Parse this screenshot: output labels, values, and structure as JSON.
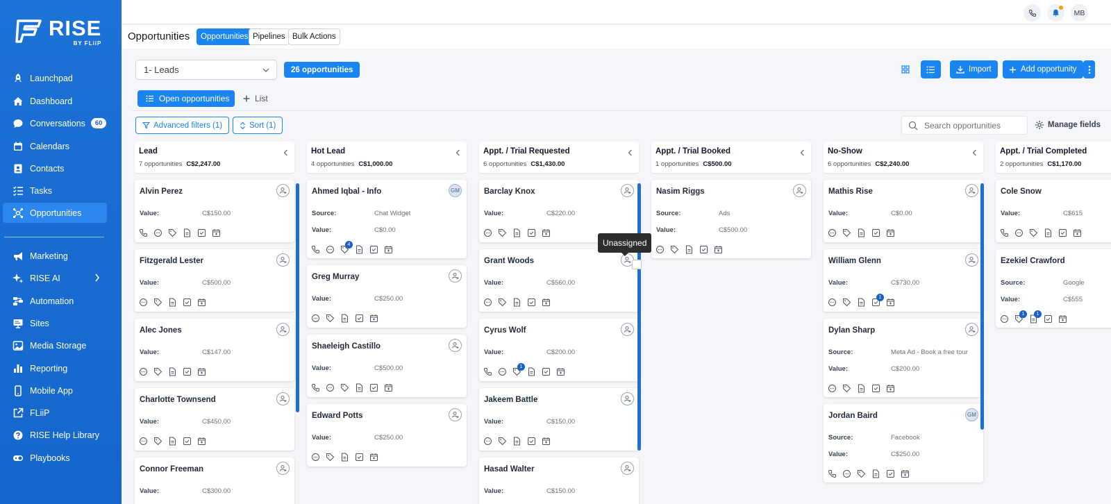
{
  "brand": {
    "name": "RISE",
    "tagline": "BY FLiiP"
  },
  "sidebar": {
    "items": [
      {
        "label": "Launchpad",
        "icon": "rocket-icon"
      },
      {
        "label": "Dashboard",
        "icon": "home-icon"
      },
      {
        "label": "Conversations",
        "icon": "chat-icon",
        "badge": "60"
      },
      {
        "label": "Calendars",
        "icon": "calendar-icon"
      },
      {
        "label": "Contacts",
        "icon": "contact-card-icon"
      },
      {
        "label": "Tasks",
        "icon": "tasks-list-icon"
      },
      {
        "label": "Opportunities",
        "icon": "opportunities-icon",
        "active": true
      },
      {
        "label": "Marketing",
        "icon": "megaphone-icon"
      },
      {
        "label": "RISE AI",
        "icon": "sparkle-icon"
      },
      {
        "label": "Automation",
        "icon": "workflow-icon"
      },
      {
        "label": "Sites",
        "icon": "monitor-icon"
      },
      {
        "label": "Media Storage",
        "icon": "image-icon"
      },
      {
        "label": "Reporting",
        "icon": "bar-chart-icon"
      },
      {
        "label": "Mobile App",
        "icon": "phone-icon"
      },
      {
        "label": "FLiiP",
        "icon": "external-link-icon"
      },
      {
        "label": "RISE Help Library",
        "icon": "help-circle-icon"
      },
      {
        "label": "Playbooks",
        "icon": "toggle-icon"
      }
    ]
  },
  "topbar": {
    "avatar_initials": "MB"
  },
  "header": {
    "title": "Opportunities",
    "tabs": [
      "Opportunities",
      "Pipelines",
      "Bulk Actions"
    ]
  },
  "toolbar": {
    "pipeline": "1- Leads",
    "count": "26 opportunities",
    "import": "Import",
    "add": "Add opportunity"
  },
  "views": {
    "active": "Open opportunities",
    "add_list": "List"
  },
  "filters": {
    "advanced": "Advanced filters (1)",
    "sort": "Sort (1)",
    "search_placeholder": "Search opportunities",
    "manage": "Manage fields"
  },
  "tooltip": "Unassigned",
  "labels": {
    "value": "Value:",
    "source": "Source:"
  },
  "columns": [
    {
      "name": "Lead",
      "count": "7 opportunities",
      "total": "C$2,247.00",
      "cards": [
        {
          "name": "Alvin Perez",
          "value": "C$150.00",
          "icons": [
            "phone",
            "chat",
            "tag",
            "doc",
            "check",
            "cal"
          ]
        },
        {
          "name": "Fitzgerald Lester",
          "value": "C$500.00",
          "icons": [
            "chat",
            "tag",
            "doc",
            "check",
            "cal"
          ]
        },
        {
          "name": "Alec Jones",
          "value": "C$147.00",
          "icons": [
            "chat",
            "tag",
            "doc",
            "check",
            "cal"
          ]
        },
        {
          "name": "Charlotte Townsend",
          "value": "C$450.00",
          "icons": [
            "chat",
            "tag",
            "doc",
            "check",
            "cal"
          ]
        },
        {
          "name": "Connor Freeman",
          "value": "C$300.00",
          "icons": []
        }
      ]
    },
    {
      "name": "Hot Lead",
      "count": "4 opportunities",
      "total": "C$1,000.00",
      "cards": [
        {
          "name": "Ahmed Iqbal - Info",
          "source": "Chat Widget",
          "value": "C$0.00",
          "avatar": "GM",
          "icons": [
            "phone",
            "chat",
            "tag:4",
            "doc",
            "check",
            "cal"
          ]
        },
        {
          "name": "Greg Murray",
          "value": "C$250.00",
          "icons": [
            "chat",
            "tag",
            "doc",
            "check",
            "cal"
          ]
        },
        {
          "name": "Shaeleigh Castillo",
          "value": "C$500.00",
          "icons": [
            "phone",
            "chat",
            "tag",
            "doc",
            "check",
            "cal"
          ]
        },
        {
          "name": "Edward Potts",
          "value": "C$250.00",
          "icons": [
            "chat",
            "tag",
            "doc",
            "check",
            "cal"
          ]
        }
      ]
    },
    {
      "name": "Appt. / Trial Requested",
      "count": "6 opportunities",
      "total": "C$1,430.00",
      "cards": [
        {
          "name": "Barclay Knox",
          "value": "C$220.00",
          "icons": [
            "chat",
            "tag",
            "doc",
            "check",
            "cal"
          ]
        },
        {
          "name": "Grant Woods",
          "value": "C$560.00",
          "icons": [
            "chat",
            "tag",
            "doc",
            "check",
            "cal"
          ]
        },
        {
          "name": "Cyrus Wolf",
          "value": "C$200.00",
          "icons": [
            "phone",
            "chat",
            "tag:1",
            "doc",
            "check",
            "cal"
          ]
        },
        {
          "name": "Jakeem Battle",
          "value": "C$150.00",
          "icons": [
            "chat",
            "tag",
            "doc",
            "check",
            "cal"
          ]
        },
        {
          "name": "Hasad Walter",
          "value": "C$150.00",
          "icons": []
        }
      ]
    },
    {
      "name": "Appt. / Trial Booked",
      "count": "1 opportunities",
      "total": "C$500.00",
      "cards": [
        {
          "name": "Nasim Riggs",
          "source": "Ads",
          "value": "C$500.00",
          "icons": [
            "chat",
            "tag",
            "doc",
            "check",
            "cal"
          ]
        }
      ]
    },
    {
      "name": "No-Show",
      "count": "6 opportunities",
      "total": "C$2,240.00",
      "cards": [
        {
          "name": "Mathis Rise",
          "value": "C$0.00",
          "icons": [
            "chat",
            "tag",
            "doc",
            "check",
            "cal"
          ]
        },
        {
          "name": "William Glenn",
          "value": "C$730.00",
          "icons": [
            "chat",
            "tag",
            "doc",
            "check:1",
            "cal"
          ]
        },
        {
          "name": "Dylan Sharp",
          "source": "Meta Ad - Book a free tour",
          "value": "C$200.00",
          "icons": [
            "chat",
            "tag",
            "doc",
            "check",
            "cal"
          ]
        },
        {
          "name": "Jordan Baird",
          "source": "Facebook",
          "value": "C$250.00",
          "avatar": "GM",
          "icons": [
            "phone",
            "chat",
            "tag",
            "doc",
            "check",
            "cal"
          ]
        }
      ]
    },
    {
      "name": "Appt. / Trial Completed",
      "count": "2 opportunities",
      "total": "C$1,170.00",
      "cards": [
        {
          "name": "Cole Snow",
          "value": "C$615",
          "icons": [
            "phone",
            "chat",
            "tag",
            "doc",
            "check",
            "cal"
          ]
        },
        {
          "name": "Ezekiel Crawford",
          "source": "Google",
          "value": "C$555",
          "icons": [
            "chat",
            "tag:1",
            "doc:1",
            "check",
            "cal"
          ]
        }
      ]
    }
  ]
}
